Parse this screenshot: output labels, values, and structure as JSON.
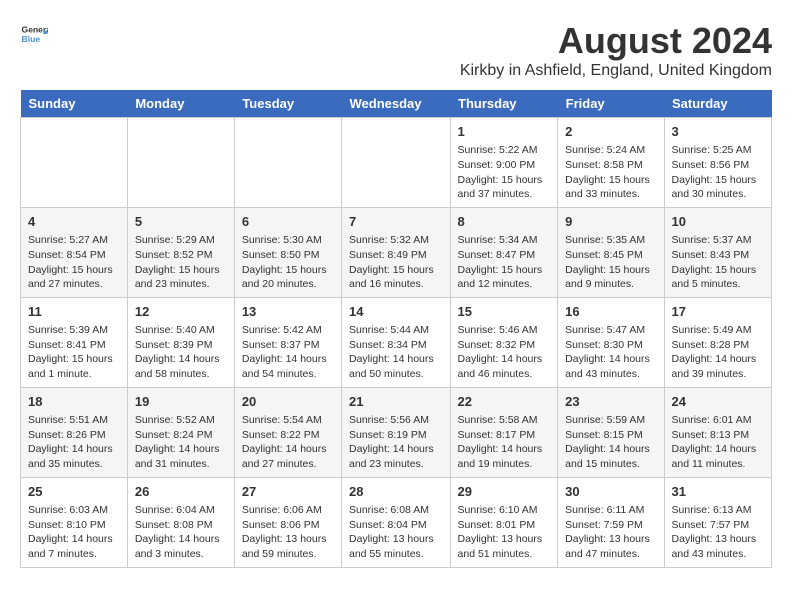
{
  "logo": {
    "text_general": "General",
    "text_blue": "Blue"
  },
  "title": "August 2024",
  "subtitle": "Kirkby in Ashfield, England, United Kingdom",
  "headers": [
    "Sunday",
    "Monday",
    "Tuesday",
    "Wednesday",
    "Thursday",
    "Friday",
    "Saturday"
  ],
  "weeks": [
    [
      {
        "day": "",
        "content": ""
      },
      {
        "day": "",
        "content": ""
      },
      {
        "day": "",
        "content": ""
      },
      {
        "day": "",
        "content": ""
      },
      {
        "day": "1",
        "content": "Sunrise: 5:22 AM\nSunset: 9:00 PM\nDaylight: 15 hours\nand 37 minutes."
      },
      {
        "day": "2",
        "content": "Sunrise: 5:24 AM\nSunset: 8:58 PM\nDaylight: 15 hours\nand 33 minutes."
      },
      {
        "day": "3",
        "content": "Sunrise: 5:25 AM\nSunset: 8:56 PM\nDaylight: 15 hours\nand 30 minutes."
      }
    ],
    [
      {
        "day": "4",
        "content": "Sunrise: 5:27 AM\nSunset: 8:54 PM\nDaylight: 15 hours\nand 27 minutes."
      },
      {
        "day": "5",
        "content": "Sunrise: 5:29 AM\nSunset: 8:52 PM\nDaylight: 15 hours\nand 23 minutes."
      },
      {
        "day": "6",
        "content": "Sunrise: 5:30 AM\nSunset: 8:50 PM\nDaylight: 15 hours\nand 20 minutes."
      },
      {
        "day": "7",
        "content": "Sunrise: 5:32 AM\nSunset: 8:49 PM\nDaylight: 15 hours\nand 16 minutes."
      },
      {
        "day": "8",
        "content": "Sunrise: 5:34 AM\nSunset: 8:47 PM\nDaylight: 15 hours\nand 12 minutes."
      },
      {
        "day": "9",
        "content": "Sunrise: 5:35 AM\nSunset: 8:45 PM\nDaylight: 15 hours\nand 9 minutes."
      },
      {
        "day": "10",
        "content": "Sunrise: 5:37 AM\nSunset: 8:43 PM\nDaylight: 15 hours\nand 5 minutes."
      }
    ],
    [
      {
        "day": "11",
        "content": "Sunrise: 5:39 AM\nSunset: 8:41 PM\nDaylight: 15 hours\nand 1 minute."
      },
      {
        "day": "12",
        "content": "Sunrise: 5:40 AM\nSunset: 8:39 PM\nDaylight: 14 hours\nand 58 minutes."
      },
      {
        "day": "13",
        "content": "Sunrise: 5:42 AM\nSunset: 8:37 PM\nDaylight: 14 hours\nand 54 minutes."
      },
      {
        "day": "14",
        "content": "Sunrise: 5:44 AM\nSunset: 8:34 PM\nDaylight: 14 hours\nand 50 minutes."
      },
      {
        "day": "15",
        "content": "Sunrise: 5:46 AM\nSunset: 8:32 PM\nDaylight: 14 hours\nand 46 minutes."
      },
      {
        "day": "16",
        "content": "Sunrise: 5:47 AM\nSunset: 8:30 PM\nDaylight: 14 hours\nand 43 minutes."
      },
      {
        "day": "17",
        "content": "Sunrise: 5:49 AM\nSunset: 8:28 PM\nDaylight: 14 hours\nand 39 minutes."
      }
    ],
    [
      {
        "day": "18",
        "content": "Sunrise: 5:51 AM\nSunset: 8:26 PM\nDaylight: 14 hours\nand 35 minutes."
      },
      {
        "day": "19",
        "content": "Sunrise: 5:52 AM\nSunset: 8:24 PM\nDaylight: 14 hours\nand 31 minutes."
      },
      {
        "day": "20",
        "content": "Sunrise: 5:54 AM\nSunset: 8:22 PM\nDaylight: 14 hours\nand 27 minutes."
      },
      {
        "day": "21",
        "content": "Sunrise: 5:56 AM\nSunset: 8:19 PM\nDaylight: 14 hours\nand 23 minutes."
      },
      {
        "day": "22",
        "content": "Sunrise: 5:58 AM\nSunset: 8:17 PM\nDaylight: 14 hours\nand 19 minutes."
      },
      {
        "day": "23",
        "content": "Sunrise: 5:59 AM\nSunset: 8:15 PM\nDaylight: 14 hours\nand 15 minutes."
      },
      {
        "day": "24",
        "content": "Sunrise: 6:01 AM\nSunset: 8:13 PM\nDaylight: 14 hours\nand 11 minutes."
      }
    ],
    [
      {
        "day": "25",
        "content": "Sunrise: 6:03 AM\nSunset: 8:10 PM\nDaylight: 14 hours\nand 7 minutes."
      },
      {
        "day": "26",
        "content": "Sunrise: 6:04 AM\nSunset: 8:08 PM\nDaylight: 14 hours\nand 3 minutes."
      },
      {
        "day": "27",
        "content": "Sunrise: 6:06 AM\nSunset: 8:06 PM\nDaylight: 13 hours\nand 59 minutes."
      },
      {
        "day": "28",
        "content": "Sunrise: 6:08 AM\nSunset: 8:04 PM\nDaylight: 13 hours\nand 55 minutes."
      },
      {
        "day": "29",
        "content": "Sunrise: 6:10 AM\nSunset: 8:01 PM\nDaylight: 13 hours\nand 51 minutes."
      },
      {
        "day": "30",
        "content": "Sunrise: 6:11 AM\nSunset: 7:59 PM\nDaylight: 13 hours\nand 47 minutes."
      },
      {
        "day": "31",
        "content": "Sunrise: 6:13 AM\nSunset: 7:57 PM\nDaylight: 13 hours\nand 43 minutes."
      }
    ]
  ]
}
